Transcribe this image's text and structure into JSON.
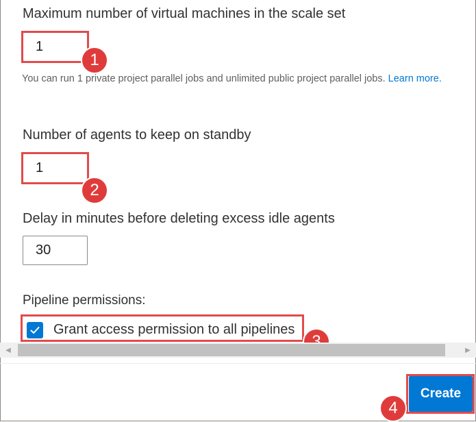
{
  "fields": {
    "max_vms": {
      "label": "Maximum number of virtual machines in the scale set",
      "value": "1",
      "help_text": "You can run 1 private project parallel jobs and unlimited public project parallel jobs.",
      "help_link": "Learn more."
    },
    "standby": {
      "label": "Number of agents to keep on standby",
      "value": "1"
    },
    "delay": {
      "label": "Delay in minutes before deleting excess idle agents",
      "value": "30"
    }
  },
  "pipeline": {
    "section_label": "Pipeline permissions:",
    "grant_label": "Grant access permission to all pipelines",
    "checked": true
  },
  "actions": {
    "create_label": "Create"
  },
  "annotations": {
    "badge1": "1",
    "badge2": "2",
    "badge3": "3",
    "badge4": "4"
  },
  "colors": {
    "accent": "#0078d4",
    "annotation_red": "#e34a4a"
  }
}
